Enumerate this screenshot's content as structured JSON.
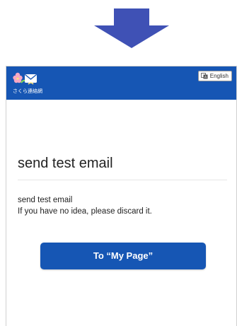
{
  "arrow": {
    "icon": "down-arrow-icon",
    "color": "#3f51b5"
  },
  "header": {
    "logo_icon": "flower-envelope-icon",
    "logo_text": "さくら連絡網",
    "background": "#1656b4",
    "language_button": {
      "icon": "language-icon",
      "label": "English"
    }
  },
  "main": {
    "title": "send test email",
    "message_line1": "send test email",
    "message_line2": "If you have no idea, please discard it."
  },
  "cta": {
    "label": "To “My Page”",
    "color": "#1656b4"
  }
}
